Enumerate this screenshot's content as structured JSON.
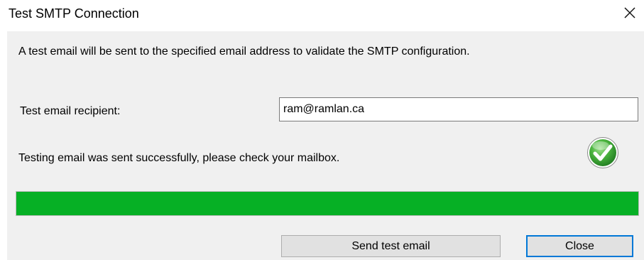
{
  "window": {
    "title": "Test SMTP Connection",
    "close_icon": "close-icon"
  },
  "description": "A test email will be sent to the specified email address to validate the SMTP configuration.",
  "recipient": {
    "label": "Test email recipient:",
    "value": "ram@ramlan.ca"
  },
  "status": {
    "text": "Testing email was sent successfully, please check your mailbox.",
    "icon": "success-check-icon",
    "icon_color": "#3aa639"
  },
  "progress": {
    "value_percent": 100,
    "fill_color": "#06b025"
  },
  "buttons": {
    "send_label": "Send test email",
    "close_label": "Close"
  }
}
